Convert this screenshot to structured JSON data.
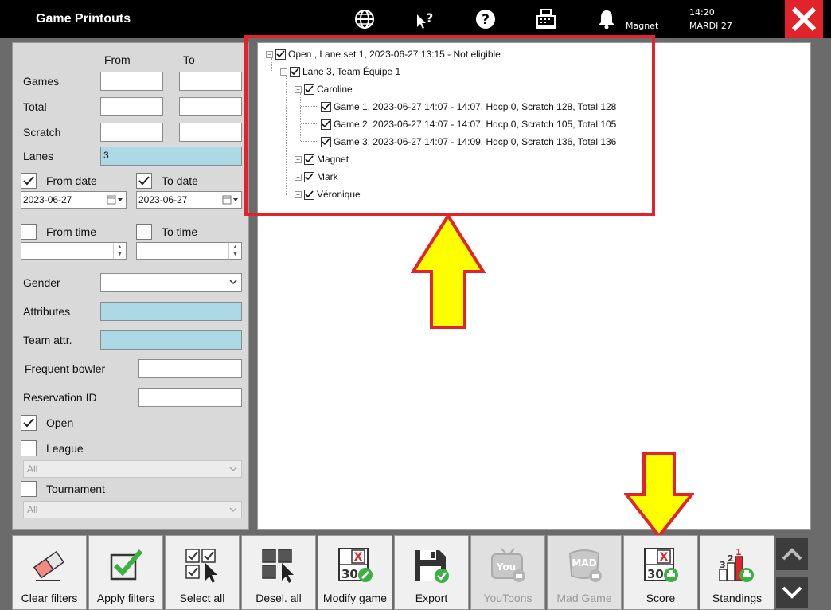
{
  "window": {
    "title": "Game Printouts"
  },
  "titlebar": {
    "user": "Magnet",
    "time": "14:20",
    "day": "MARDI 27"
  },
  "filters": {
    "from_header": "From",
    "to_header": "To",
    "games_label": "Games",
    "total_label": "Total",
    "scratch_label": "Scratch",
    "lanes_label": "Lanes",
    "lanes_value": "3",
    "from_date_label": "From date",
    "from_date_checked": true,
    "from_date_value": "2023-06-27",
    "to_date_label": "To date",
    "to_date_checked": true,
    "to_date_value": "2023-06-27",
    "from_time_label": "From time",
    "from_time_checked": false,
    "to_time_label": "To time",
    "to_time_checked": false,
    "gender_label": "Gender",
    "attributes_label": "Attributes",
    "team_attr_label": "Team attr.",
    "frequent_bowler_label": "Frequent bowler",
    "reservation_id_label": "Reservation ID",
    "open_label": "Open",
    "open_checked": true,
    "league_label": "League",
    "league_checked": false,
    "league_select": "All",
    "tournament_label": "Tournament",
    "tournament_checked": false,
    "tournament_select": "All"
  },
  "tree": {
    "root": "Open , Lane set 1, 2023-06-27 13:15  - Not eligible",
    "lane": "Lane 3, Team Équipe 1",
    "bowlers": [
      {
        "name": "Caroline",
        "games": [
          "Game 1, 2023-06-27 14:07 - 14:07, Hdcp 0, Scratch 128, Total 128",
          "Game 2, 2023-06-27 14:07 - 14:07, Hdcp 0, Scratch 105, Total 105",
          "Game 3, 2023-06-27 14:07 - 14:09, Hdcp 0, Scratch 136, Total 136"
        ]
      },
      {
        "name": "Magnet"
      },
      {
        "name": "Mark"
      },
      {
        "name": "Véronique"
      }
    ]
  },
  "toolbar": {
    "clear_filters": "Clear filters",
    "apply_filters": "Apply filters",
    "select_all": "Select all",
    "deselect_all": "Desel. all",
    "modify_game": "Modify game",
    "export": "Export",
    "youtoons": "YouToons",
    "mad_game": "Mad Game",
    "score": "Score",
    "standings": "Standings"
  },
  "icon_text": {
    "thirty": "30",
    "x": "X",
    "youtoons_logo": "You",
    "mad_logo": "MAD",
    "rank1": "1",
    "rank2": "2",
    "rank3": "3"
  },
  "colors": {
    "close_red": "#e2232a",
    "annotation_red": "#e2232a",
    "arrow_yellow": "#ffff00",
    "field_blue": "#add8e6",
    "check_green": "#3cb043"
  }
}
